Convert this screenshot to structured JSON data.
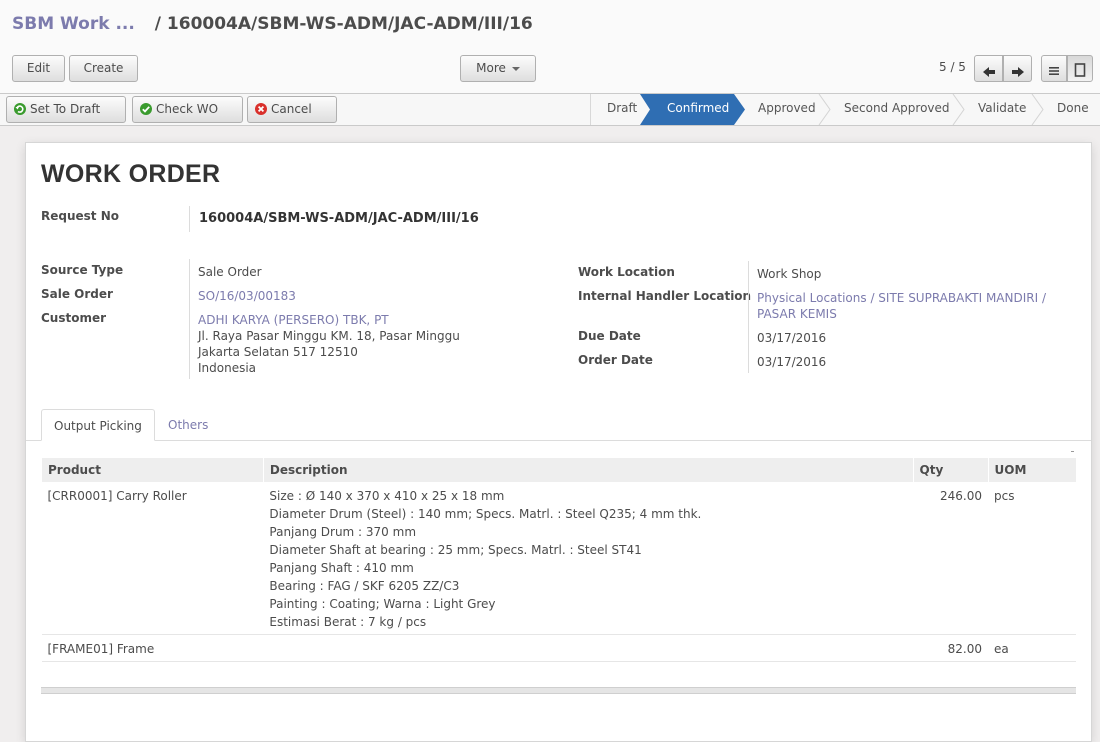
{
  "breadcrumb": {
    "parent": "SBM Work ...",
    "separator": "/",
    "current": "160004A/SBM-WS-ADM/JAC-ADM/III/16"
  },
  "toolbar": {
    "edit_label": "Edit",
    "create_label": "Create",
    "more_label": "More",
    "pager": "5 / 5"
  },
  "actions": {
    "set_to_draft": "Set To Draft",
    "check_wo": "Check WO",
    "cancel": "Cancel"
  },
  "statusbar": {
    "steps": [
      "Draft",
      "Confirmed",
      "Approved",
      "Second Approved",
      "Validate",
      "Done"
    ],
    "active": "Confirmed",
    "active_color": "#2f6eb3"
  },
  "form": {
    "title": "WORK ORDER",
    "request_no_label": "Request No",
    "request_no": "160004A/SBM-WS-ADM/JAC-ADM/III/16",
    "source_type_label": "Source Type",
    "source_type": "Sale Order",
    "sale_order_label": "Sale Order",
    "sale_order": "SO/16/03/00183",
    "customer_label": "Customer",
    "customer_name": "ADHI KARYA (PERSERO) TBK, PT",
    "customer_address": [
      "Jl. Raya Pasar Minggu KM. 18, Pasar Minggu",
      "Jakarta Selatan 517 12510",
      "Indonesia"
    ],
    "work_location_label": "Work Location",
    "work_location": "Work Shop",
    "internal_handler_label": "Internal Handler Location",
    "internal_handler_line1": "Physical Locations / SITE SUPRABAKTI MANDIRI /",
    "internal_handler_line2": "PASAR KEMIS",
    "due_date_label": "Due Date",
    "due_date": "03/17/2016",
    "order_date_label": "Order Date",
    "order_date": "03/17/2016"
  },
  "tabs": [
    "Output Picking",
    "Others"
  ],
  "table": {
    "headers": [
      "Product",
      "Description",
      "Qty",
      "UOM"
    ],
    "rows": [
      {
        "product": "[CRR0001] Carry Roller",
        "description": [
          "Size : Ø 140 x 370 x 410 x 25 x 18 mm",
          "Diameter Drum (Steel) : 140 mm; Specs. Matrl. : Steel Q235; 4 mm thk.",
          "Panjang Drum : 370 mm",
          "Diameter Shaft at bearing : 25 mm; Specs. Matrl. : Steel ST41",
          "Panjang Shaft : 410 mm",
          "Bearing : FAG / SKF 6205 ZZ/C3",
          "Painting : Coating; Warna : Light Grey",
          "Estimasi Berat : 7 kg / pcs"
        ],
        "qty": "246.00",
        "uom": "pcs"
      },
      {
        "product": "[FRAME01] Frame",
        "description": [],
        "qty": "82.00",
        "uom": "ea"
      }
    ]
  },
  "colors": {
    "link": "#7c7bad",
    "active_step": "#2f6eb3"
  }
}
